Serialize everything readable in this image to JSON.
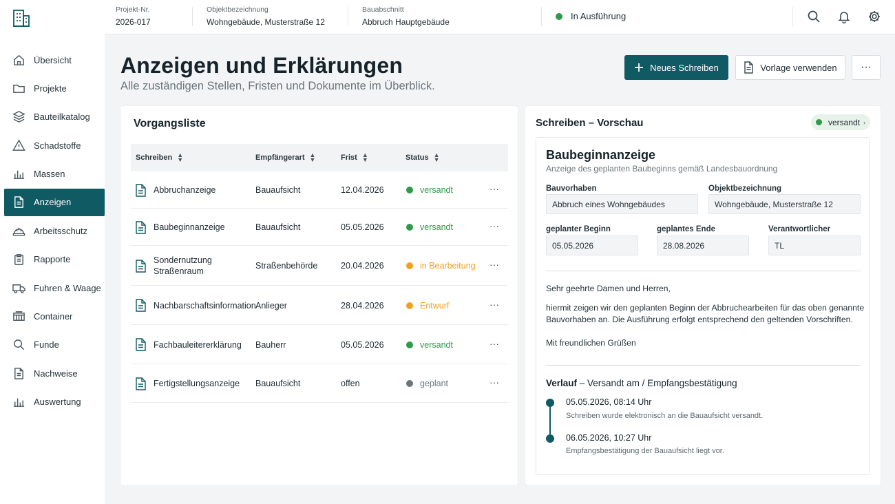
{
  "sidebar": {
    "items": [
      {
        "label": "Übersicht",
        "icon": "home-icon"
      },
      {
        "label": "Projekte",
        "icon": "folder-icon"
      },
      {
        "label": "Bauteilkatalog",
        "icon": "layers-icon"
      },
      {
        "label": "Schadstoffe",
        "icon": "warning-icon"
      },
      {
        "label": "Massen",
        "icon": "bar-chart-icon"
      },
      {
        "label": "Anzeigen",
        "icon": "document-icon",
        "active": true
      },
      {
        "label": "Arbeitsschutz",
        "icon": "helmet-icon"
      },
      {
        "label": "Rapporte",
        "icon": "clipboard-icon"
      },
      {
        "label": "Fuhren & Waage",
        "icon": "truck-icon"
      },
      {
        "label": "Container",
        "icon": "container-icon"
      },
      {
        "label": "Funde",
        "icon": "search-icon"
      },
      {
        "label": "Nachweise",
        "icon": "document-icon"
      },
      {
        "label": "Auswertung",
        "icon": "bar-chart-icon"
      }
    ]
  },
  "topbar": {
    "project_label": "Projekt-Nr.",
    "project_value": "2026-017",
    "object_label": "Objektbezeichnung",
    "object_value": "Wohngebäude, Musterstraße 12",
    "section_label": "Bauabschnitt",
    "section_value": "Abbruch Hauptgebäude",
    "status": "In Ausführung",
    "status_color": "#2e9a4a"
  },
  "header": {
    "title": "Anzeigen und Erklärungen",
    "subtitle": "Alle zuständigen Stellen, Fristen und Dokumente im Überblick.",
    "primary_button": "Neues Schreiben",
    "secondary_button": "Vorlage verwenden",
    "more_button": "···"
  },
  "list": {
    "title": "Vorgangsliste",
    "columns": [
      "Schreiben",
      "Empfängerart",
      "Frist",
      "Status"
    ],
    "rows": [
      {
        "name": "Abbruchanzeige",
        "recipient": "Bauaufsicht",
        "deadline": "12.04.2026",
        "status": "versandt",
        "color": "#2e9a4a"
      },
      {
        "name": "Baubeginnanzeige",
        "recipient": "Bauaufsicht",
        "deadline": "05.05.2026",
        "status": "versandt",
        "color": "#2e9a4a"
      },
      {
        "name": "Sondernutzung Straßenraum",
        "recipient": "Straßenbehörde",
        "deadline": "20.04.2026",
        "status": "in Bearbeitung",
        "color": "#f0a020"
      },
      {
        "name": "Nachbarschaftsinformation",
        "recipient": "Anlieger",
        "deadline": "28.04.2026",
        "status": "Entwurf",
        "color": "#f0a020"
      },
      {
        "name": "Fachbauleitererklärung",
        "recipient": "Bauherr",
        "deadline": "05.05.2026",
        "status": "versandt",
        "color": "#2e9a4a"
      },
      {
        "name": "Fertigstellungsanzeige",
        "recipient": "Bauaufsicht",
        "deadline": "offen",
        "status": "geplant",
        "color": "#6b757a"
      }
    ],
    "row_menu": "···"
  },
  "preview": {
    "card_title": "Schreiben – Vorschau",
    "badge": "versandt",
    "badge_color": "#2e9a4a",
    "doc_title": "Baubeginnanzeige",
    "doc_subtitle": "Anzeige des geplanten Baubeginns gemäß Landesbauordnung",
    "fields": {
      "project_label": "Bauvorhaben",
      "project_value": "Abbruch eines Wohngebäudes",
      "object_label": "Objektbezeichnung",
      "object_value": "Wohngebäude, Musterstraße 12",
      "start_label": "geplanter Beginn",
      "start_value": "05.05.2026",
      "end_label": "geplantes Ende",
      "end_value": "28.08.2026",
      "responsible_label": "Verantwortlicher",
      "responsible_value": "TL"
    },
    "salutation": "Sehr geehrte Damen und Herren,",
    "body_line1": "hiermit zeigen wir den geplanten Beginn der Abbruchearbeiten für das oben genannte",
    "body_line2": "Bauvorhaben an. Die Ausführung erfolgt entsprechend den geltenden Vorschriften.",
    "closing": "Mit freundlichen Grüßen",
    "history_title": "Verlauf",
    "history_subtitle": " – Versandt am / Empfangsbestätigung",
    "history": [
      {
        "time": "05.05.2026, 08:14 Uhr",
        "desc": "Schreiben wurde elektronisch an die Bauaufsicht versandt."
      },
      {
        "time": "06.05.2026, 10:27 Uhr",
        "desc": "Empfangsbestätigung der Bauaufsicht liegt vor."
      }
    ]
  },
  "colors": {
    "accent": "#0f5a63",
    "green": "#2e9a4a",
    "orange": "#f0a020",
    "grey": "#6b757a"
  }
}
